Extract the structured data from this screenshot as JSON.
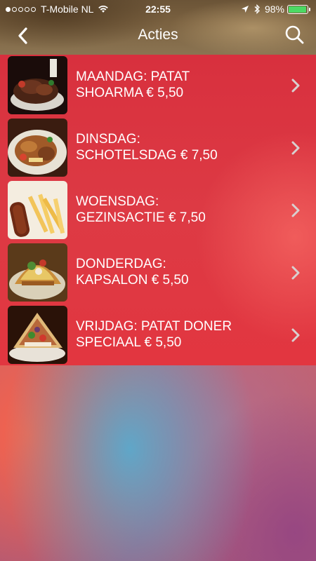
{
  "status_bar": {
    "signal_dots_filled": 1,
    "signal_dots_total": 5,
    "carrier": "T-Mobile NL",
    "time": "22:55",
    "battery_percent": "98%",
    "battery_level": 0.98,
    "battery_color": "#4cd964"
  },
  "navbar": {
    "title": "Acties",
    "back_icon": "chevron-left-icon",
    "search_icon": "search-icon"
  },
  "items": [
    {
      "line1": "MAANDAG: PATAT",
      "line2": "SHOARMA € 5,50"
    },
    {
      "line1": "DINSDAG:",
      "line2": "SCHOTELSDAG € 7,50"
    },
    {
      "line1": "WOENSDAG:",
      "line2": "GEZINSACTIE € 7,50"
    },
    {
      "line1": "DONDERDAG:",
      "line2": "KAPSALON € 5,50"
    },
    {
      "line1": "VRIJDAG: PATAT DONER",
      "line2": "SPECIAAL € 5,50"
    }
  ]
}
